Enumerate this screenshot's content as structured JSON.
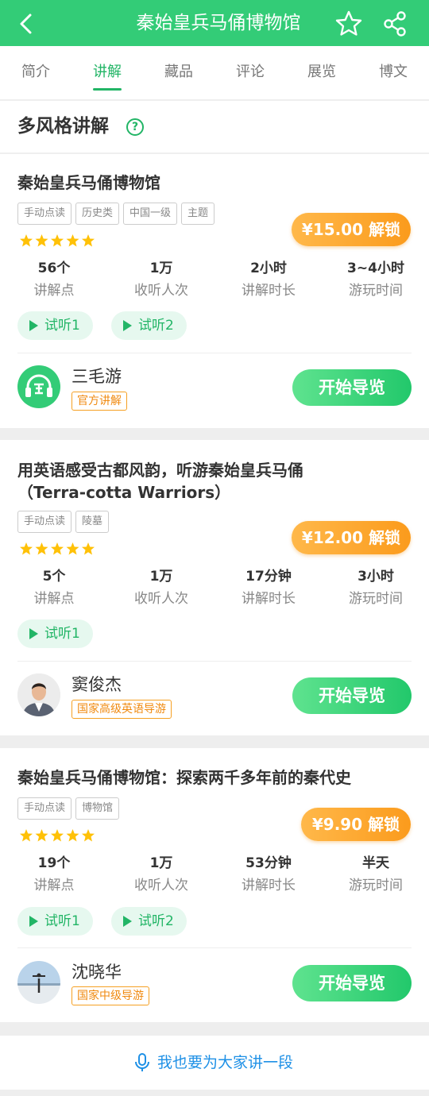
{
  "header": {
    "title": "秦始皇兵马俑博物馆",
    "colors": {
      "bar": "#33cc77",
      "accent": "#22b566",
      "price": "#fb9b1c",
      "link": "#1e90e6"
    },
    "icons": [
      "back-arrow-icon",
      "star-outline-icon",
      "share-icon"
    ]
  },
  "tabs": [
    {
      "label": "简介",
      "active": false
    },
    {
      "label": "讲解",
      "active": true
    },
    {
      "label": "藏品",
      "active": false
    },
    {
      "label": "评论",
      "active": false
    },
    {
      "label": "展览",
      "active": false
    },
    {
      "label": "博文",
      "active": false
    }
  ],
  "section": {
    "title": "多风格讲解",
    "help_icon": "?"
  },
  "tours": [
    {
      "title": "秦始皇兵马俑博物馆",
      "tags": [
        "手动点读",
        "历史类",
        "中国一级",
        "主题"
      ],
      "rating": 5,
      "price_label": "¥15.00 解锁",
      "stats": [
        {
          "value": "56个",
          "label": "讲解点"
        },
        {
          "value": "1万",
          "label": "收听人次"
        },
        {
          "value": "2小时",
          "label": "讲解时长"
        },
        {
          "value": "3~4小时",
          "label": "游玩时间"
        }
      ],
      "previews": [
        "试听1",
        "试听2"
      ],
      "guide": {
        "name": "三毛游",
        "badge": "官方讲解"
      },
      "start_label": "开始导览"
    },
    {
      "title_line1": "用英语感受古都风韵，听游秦始皇兵马俑",
      "title_line2": "（Terra-cotta Warriors）",
      "tags": [
        "手动点读",
        "陵墓"
      ],
      "rating": 5,
      "price_label": "¥12.00 解锁",
      "stats": [
        {
          "value": "5个",
          "label": "讲解点"
        },
        {
          "value": "1万",
          "label": "收听人次"
        },
        {
          "value": "17分钟",
          "label": "讲解时长"
        },
        {
          "value": "3小时",
          "label": "游玩时间"
        }
      ],
      "previews": [
        "试听1"
      ],
      "guide": {
        "name": "窦俊杰",
        "badge": "国家高级英语导游"
      },
      "start_label": "开始导览"
    },
    {
      "title": "秦始皇兵马俑博物馆：探索两千多年前的秦代史",
      "tags": [
        "手动点读",
        "博物馆"
      ],
      "rating": 5,
      "price_label": "¥9.90 解锁",
      "stats": [
        {
          "value": "19个",
          "label": "讲解点"
        },
        {
          "value": "1万",
          "label": "收听人次"
        },
        {
          "value": "53分钟",
          "label": "讲解时长"
        },
        {
          "value": "半天",
          "label": "游玩时间"
        }
      ],
      "previews": [
        "试听1",
        "试听2"
      ],
      "guide": {
        "name": "沈晓华",
        "badge": "国家中级导游"
      },
      "start_label": "开始导览"
    }
  ],
  "footer": {
    "label": "我也要为大家讲一段",
    "icon": "microphone-icon"
  }
}
